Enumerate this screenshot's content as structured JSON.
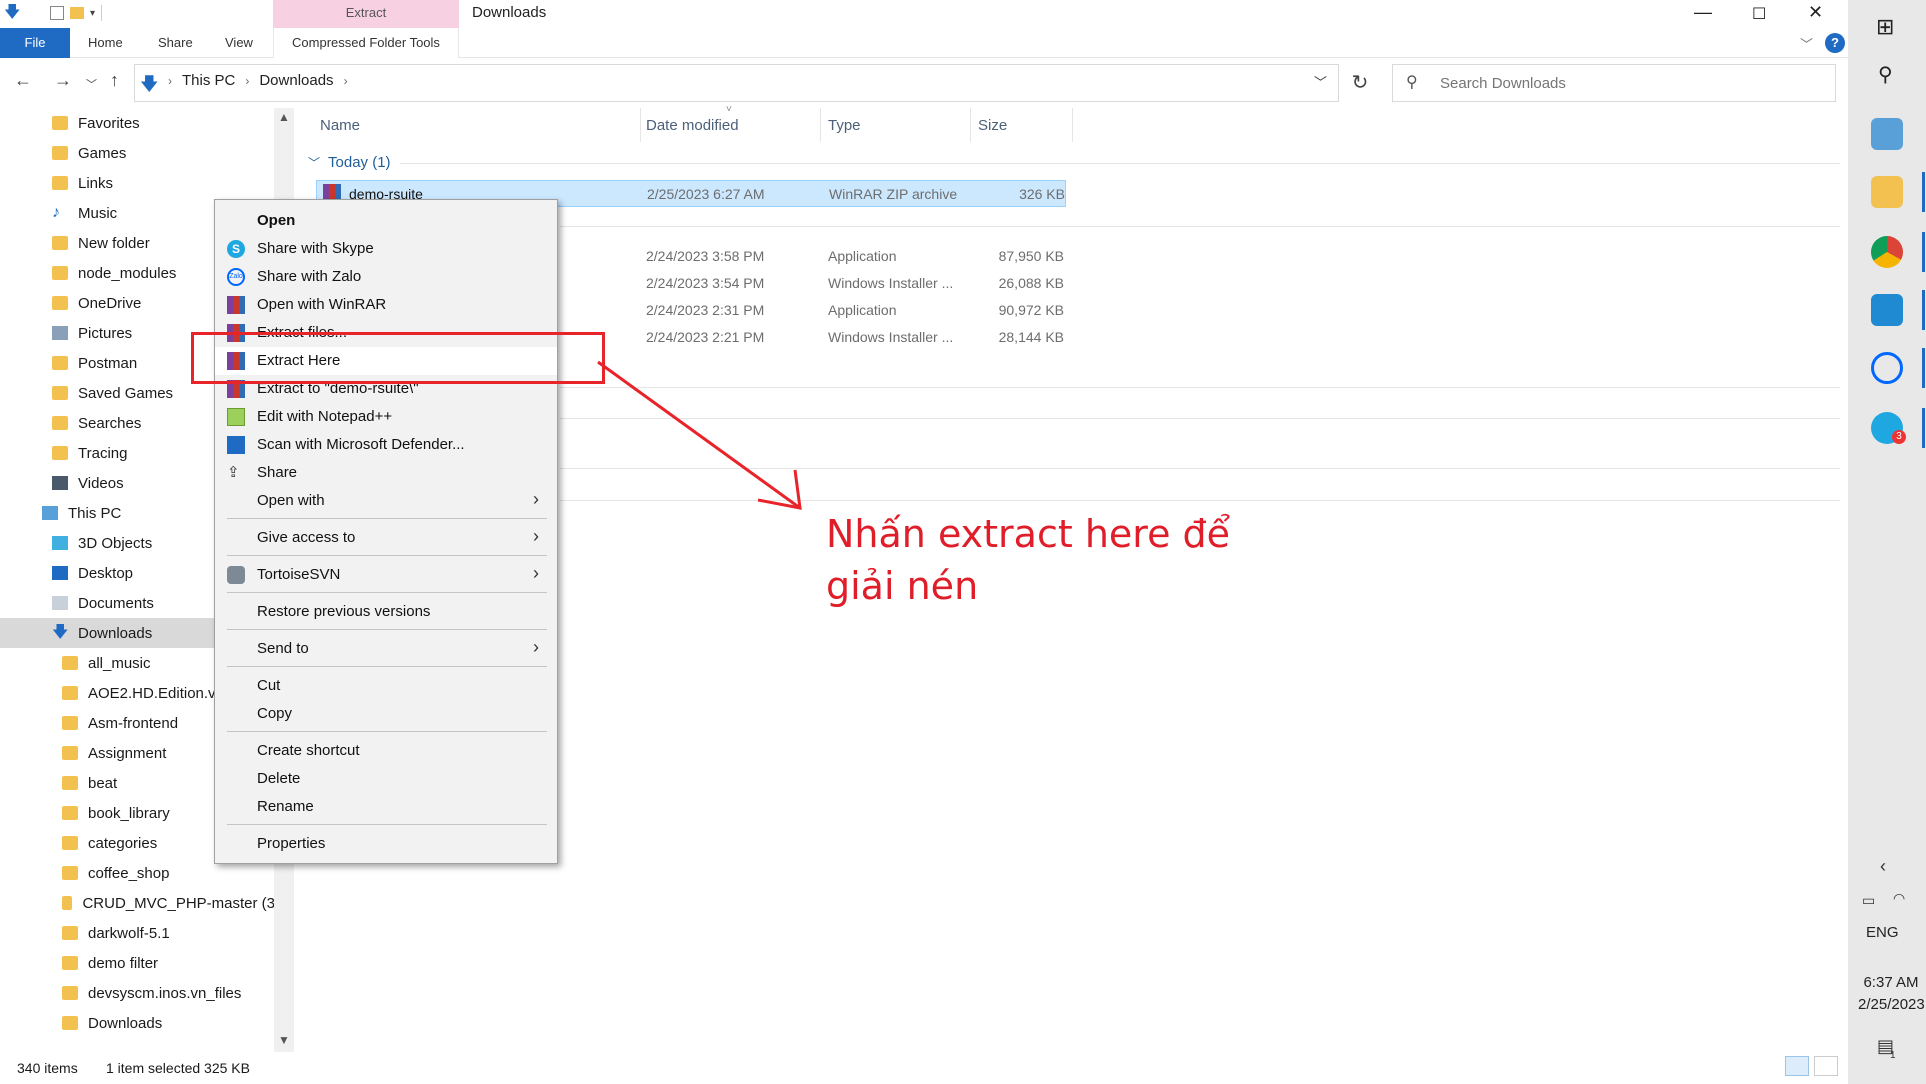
{
  "window": {
    "title": "Downloads",
    "context_tab_group": "Extract",
    "minimize": "—",
    "maximize": "☐",
    "close": "✕"
  },
  "ribbon": {
    "tabs": [
      "File",
      "Home",
      "Share",
      "View",
      "Compressed Folder Tools"
    ],
    "help": "?"
  },
  "address": {
    "crumbs": [
      "This PC",
      "Downloads"
    ],
    "search_placeholder": "Search Downloads"
  },
  "nav_pane": {
    "items": [
      {
        "label": "Favorites",
        "icon": "folder-icon"
      },
      {
        "label": "Games",
        "icon": "folder-icon"
      },
      {
        "label": "Links",
        "icon": "folder-icon"
      },
      {
        "label": "Music",
        "icon": "music-icon"
      },
      {
        "label": "New folder",
        "icon": "folder-icon"
      },
      {
        "label": "node_modules",
        "icon": "folder-icon"
      },
      {
        "label": "OneDrive",
        "icon": "folder-icon"
      },
      {
        "label": "Pictures",
        "icon": "pictures-icon"
      },
      {
        "label": "Postman",
        "icon": "folder-icon"
      },
      {
        "label": "Saved Games",
        "icon": "folder-icon"
      },
      {
        "label": "Searches",
        "icon": "folder-icon"
      },
      {
        "label": "Tracing",
        "icon": "folder-icon"
      },
      {
        "label": "Videos",
        "icon": "videos-icon"
      },
      {
        "label": "This PC",
        "icon": "pc-icon"
      },
      {
        "label": "3D Objects",
        "icon": "3d-objects-icon"
      },
      {
        "label": "Desktop",
        "icon": "desktop-icon"
      },
      {
        "label": "Documents",
        "icon": "documents-icon"
      },
      {
        "label": "Downloads",
        "icon": "downloads-icon"
      },
      {
        "label": "all_music",
        "icon": "folder-icon"
      },
      {
        "label": "AOE2.HD.Edition.v5",
        "icon": "folder-icon"
      },
      {
        "label": "Asm-frontend",
        "icon": "folder-icon"
      },
      {
        "label": "Assignment",
        "icon": "folder-icon"
      },
      {
        "label": "beat",
        "icon": "folder-icon"
      },
      {
        "label": "book_library",
        "icon": "folder-icon"
      },
      {
        "label": "categories",
        "icon": "folder-icon"
      },
      {
        "label": "coffee_shop",
        "icon": "folder-icon"
      },
      {
        "label": "CRUD_MVC_PHP-master (3)",
        "icon": "folder-icon"
      },
      {
        "label": "darkwolf-5.1",
        "icon": "folder-icon"
      },
      {
        "label": "demo filter",
        "icon": "folder-icon"
      },
      {
        "label": "devsyscm.inos.vn_files",
        "icon": "folder-icon"
      },
      {
        "label": "Downloads",
        "icon": "folder-icon"
      }
    ]
  },
  "file_list": {
    "columns": [
      "Name",
      "Date modified",
      "Type",
      "Size"
    ],
    "group_today": "Today (1)",
    "rows": [
      {
        "name": "demo-rsuite",
        "date": "2/25/2023 6:27 AM",
        "type": "WinRAR ZIP archive",
        "size": "326 KB",
        "selected": true
      },
      {
        "name": "",
        "date": "2/24/2023 3:58 PM",
        "type": "Application",
        "size": "87,950 KB"
      },
      {
        "name": "",
        "date": "2/24/2023 3:54 PM",
        "type": "Windows Installer ...",
        "size": "26,088 KB"
      },
      {
        "name": "",
        "date": "2/24/2023 2:31 PM",
        "type": "Application",
        "size": "90,972 KB"
      },
      {
        "name": "",
        "date": "2/24/2023 2:21 PM",
        "type": "Windows Installer ...",
        "size": "28,144 KB"
      }
    ]
  },
  "context_menu": {
    "items": [
      {
        "label": "Open",
        "icon": "",
        "bold": true
      },
      {
        "label": "Share with Skype",
        "icon": "skype-icon"
      },
      {
        "label": "Share with Zalo",
        "icon": "zalo-icon"
      },
      {
        "label": "Open with WinRAR",
        "icon": "winrar-icon"
      },
      {
        "label": "Extract files...",
        "icon": "winrar-icon"
      },
      {
        "label": "Extract Here",
        "icon": "winrar-icon"
      },
      {
        "label": "Extract to \"demo-rsuite\\\"",
        "icon": "winrar-icon"
      },
      {
        "label": "Edit with Notepad++",
        "icon": "notepad-icon"
      },
      {
        "label": "Scan with Microsoft Defender...",
        "icon": "defender-icon"
      },
      {
        "label": "Share",
        "icon": "share-icon"
      },
      {
        "label": "Open with",
        "icon": "",
        "submenu": true
      },
      {
        "label": "Give access to",
        "icon": "",
        "submenu": true
      },
      {
        "label": "TortoiseSVN",
        "icon": "tortoise-icon",
        "submenu": true
      },
      {
        "label": "Restore previous versions",
        "icon": ""
      },
      {
        "label": "Send to",
        "icon": "",
        "submenu": true
      },
      {
        "label": "Cut",
        "icon": ""
      },
      {
        "label": "Copy",
        "icon": ""
      },
      {
        "label": "Create shortcut",
        "icon": ""
      },
      {
        "label": "Delete",
        "icon": ""
      },
      {
        "label": "Rename",
        "icon": ""
      },
      {
        "label": "Properties",
        "icon": ""
      }
    ]
  },
  "annotation": {
    "line1": "Nhấn extract here để",
    "line2": "giải nén",
    "color": "#e01e2a"
  },
  "status": {
    "count": "340 items",
    "selection": "1 item selected  325 KB"
  },
  "taskbar": {
    "lang": "ENG",
    "time": "6:37 AM",
    "date": "2/25/2023",
    "notif_badge": "1",
    "skype_badge": "3"
  }
}
